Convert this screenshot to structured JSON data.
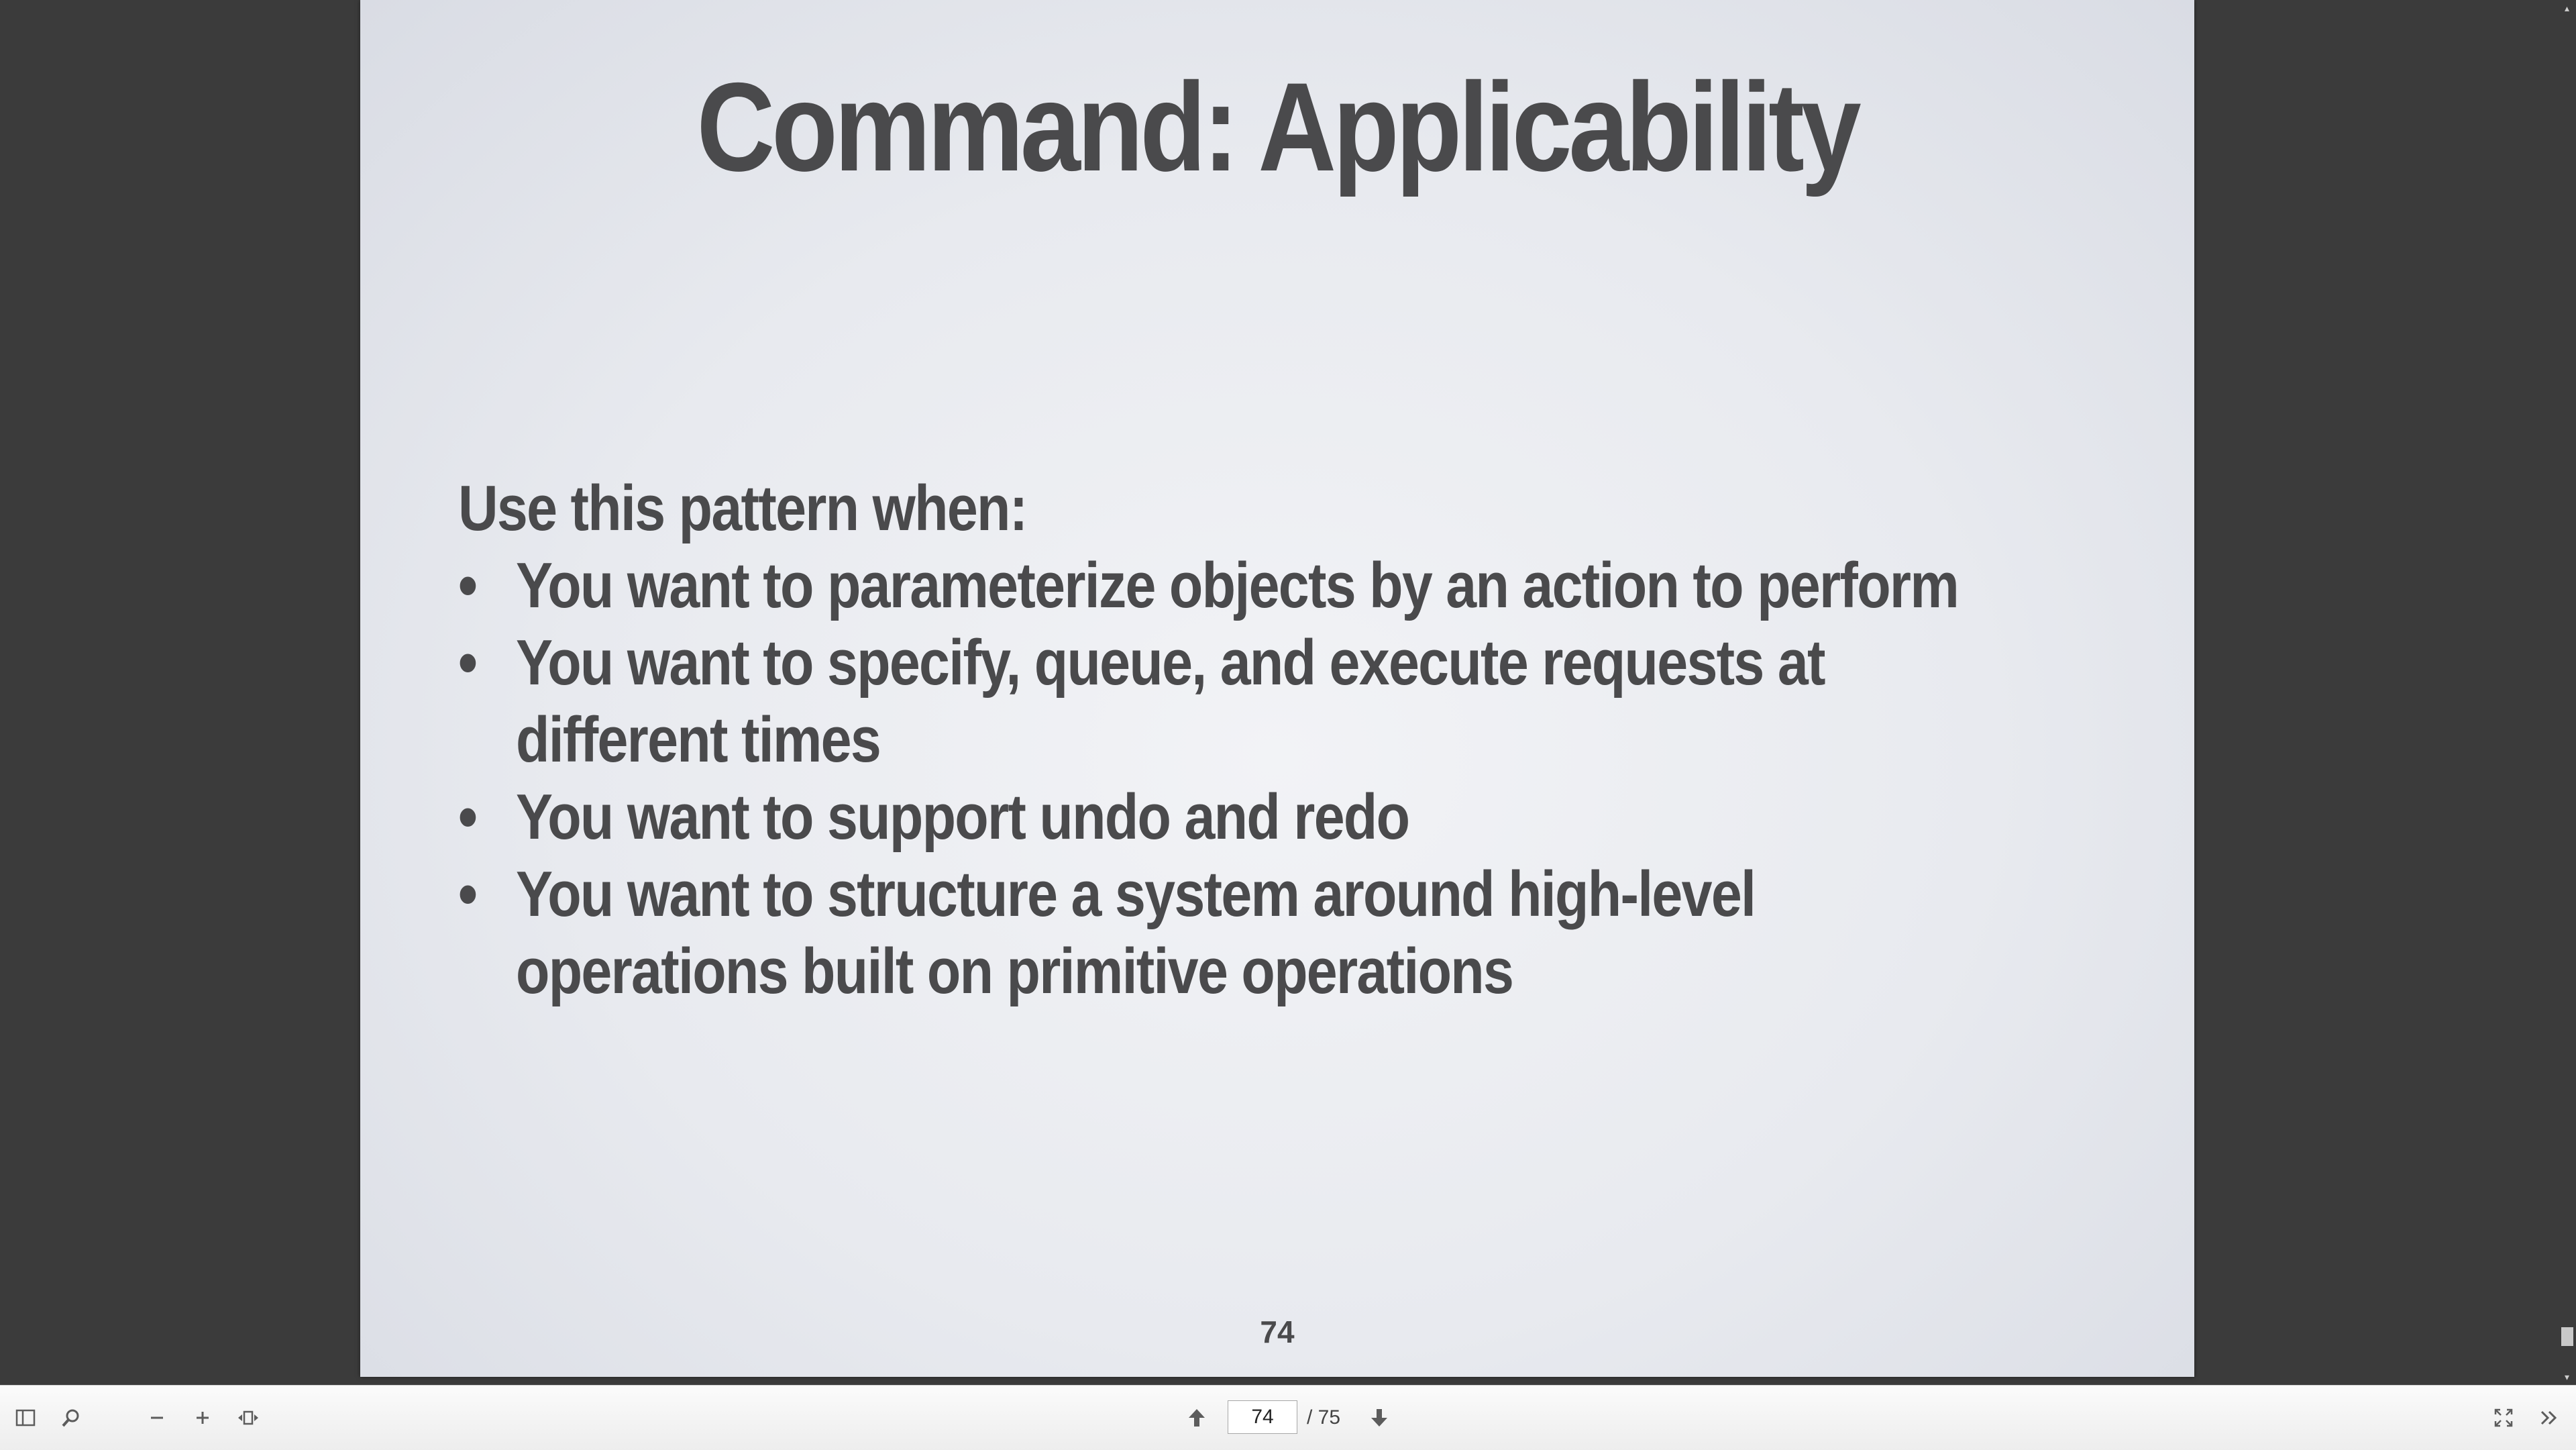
{
  "slide": {
    "title": "Command: Applicability",
    "lead": "Use this pattern when:",
    "bullets": [
      "You want to parameterize objects by an action to perform",
      "You want to specify, queue, and execute requests at different times",
      "You want to support undo and redo",
      "You want to structure a system around high-level operations built on primitive operations"
    ],
    "bullet_glyph": "•",
    "number": "74"
  },
  "toolbar": {
    "current_page": "74",
    "total_pages_label": "/ 75",
    "icons": {
      "sidebar": "sidebar-toggle-icon",
      "search": "search-icon",
      "zoom_out": "zoom-out-icon",
      "zoom_in": "zoom-in-icon",
      "fit": "fit-page-icon",
      "prev": "previous-page-icon",
      "next": "next-page-icon",
      "fullscreen": "fullscreen-icon",
      "more": "more-tools-icon"
    }
  },
  "colors": {
    "viewer_background": "#3b3b3b",
    "slide_text": "#4a4a4c",
    "toolbar_background": "#f4f4f4"
  }
}
